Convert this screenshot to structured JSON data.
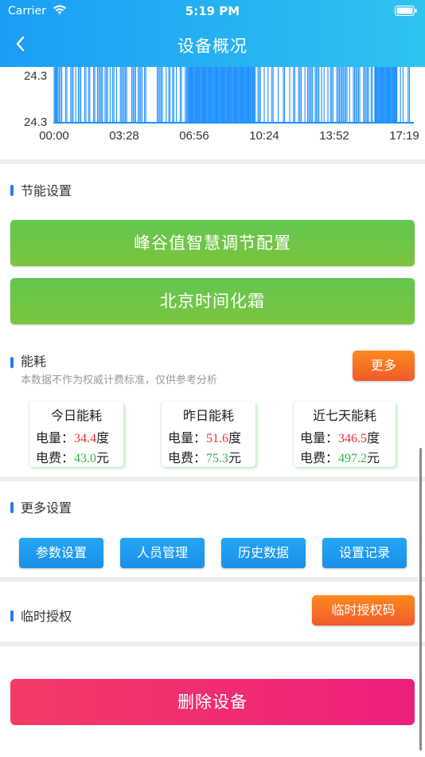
{
  "status_bar": {
    "carrier": "Carrier",
    "time": "5:19 PM"
  },
  "nav": {
    "title": "设备概况",
    "back_icon": "chevron-left-icon"
  },
  "chart_data": {
    "type": "line",
    "y_tick_labels": [
      "24.3",
      "24.3"
    ],
    "x_tick_labels": [
      "00:00",
      "03:28",
      "06:56",
      "10:24",
      "13:52",
      "17:19"
    ],
    "color": "#1e90ff"
  },
  "energy_settings": {
    "title": "节能设置",
    "buttons": [
      "峰谷值智慧调节配置",
      "北京时间化霜"
    ]
  },
  "energy": {
    "title": "能耗",
    "subtitle": "本数据不作为权威计费标准，仅供参考分析",
    "more_label": "更多",
    "cards": [
      {
        "title": "今日能耗",
        "power_label": "电量：",
        "power_value": "34.4",
        "power_unit": "度",
        "cost_label": "电费：",
        "cost_value": "43.0",
        "cost_unit": "元"
      },
      {
        "title": "昨日能耗",
        "power_label": "电量：",
        "power_value": "51.6",
        "power_unit": "度",
        "cost_label": "电费：",
        "cost_value": "75.3",
        "cost_unit": "元"
      },
      {
        "title": "近七天能耗",
        "power_label": "电量：",
        "power_value": "346.5",
        "power_unit": "度",
        "cost_label": "电费：",
        "cost_value": "497.2",
        "cost_unit": "元"
      }
    ]
  },
  "more_settings": {
    "title": "更多设置",
    "buttons": [
      "参数设置",
      "人员管理",
      "历史数据",
      "设置记录"
    ]
  },
  "temp_auth": {
    "title": "临时授权",
    "button_label": "临时授权码"
  },
  "delete_label": "删除设备",
  "colors": {
    "header_start": "#1a9ef5",
    "header_end": "#2fc3f0",
    "green_btn": "#6cc645",
    "orange_btn": "#f5702a",
    "blue_btn": "#1f9bf0",
    "delete_btn": "#f0286f"
  }
}
